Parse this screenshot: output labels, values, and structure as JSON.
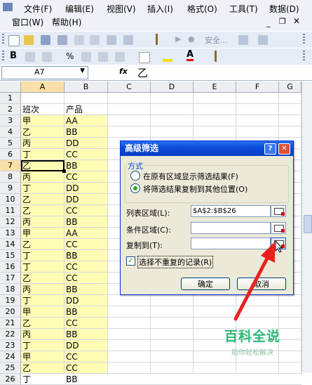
{
  "menu": {
    "row1": [
      "文件(F)",
      "编辑(E)",
      "视图(V)",
      "插入(I)",
      "格式(O)",
      "工具(T)",
      "数据(D)"
    ],
    "row2": [
      "窗口(W)",
      "帮助(H)"
    ]
  },
  "toolbar": {
    "security_label": "安全..."
  },
  "formula_bar": {
    "name_box": "A7",
    "fx": "fx",
    "content": "乙"
  },
  "grid": {
    "columns": [
      "A",
      "B",
      "C",
      "D",
      "E",
      "F",
      "G"
    ],
    "rows": [
      {
        "n": "1",
        "a": "",
        "b": ""
      },
      {
        "n": "2",
        "a": "班次",
        "b": "产品"
      },
      {
        "n": "3",
        "a": "甲",
        "b": "AA"
      },
      {
        "n": "4",
        "a": "乙",
        "b": "BB"
      },
      {
        "n": "5",
        "a": "丙",
        "b": "DD"
      },
      {
        "n": "6",
        "a": "丁",
        "b": "CC"
      },
      {
        "n": "7",
        "a": "乙",
        "b": "BB"
      },
      {
        "n": "8",
        "a": "丙",
        "b": "CC"
      },
      {
        "n": "9",
        "a": "丁",
        "b": "DD"
      },
      {
        "n": "10",
        "a": "乙",
        "b": "DD"
      },
      {
        "n": "11",
        "a": "乙",
        "b": "CC"
      },
      {
        "n": "12",
        "a": "丙",
        "b": "BB"
      },
      {
        "n": "13",
        "a": "甲",
        "b": "AA"
      },
      {
        "n": "14",
        "a": "乙",
        "b": "CC"
      },
      {
        "n": "15",
        "a": "丁",
        "b": "BB"
      },
      {
        "n": "16",
        "a": "丁",
        "b": "CC"
      },
      {
        "n": "17",
        "a": "乙",
        "b": "CC"
      },
      {
        "n": "18",
        "a": "丙",
        "b": "BB"
      },
      {
        "n": "19",
        "a": "丁",
        "b": "DD"
      },
      {
        "n": "20",
        "a": "甲",
        "b": "BB"
      },
      {
        "n": "21",
        "a": "乙",
        "b": "CC"
      },
      {
        "n": "22",
        "a": "丙",
        "b": "BB"
      },
      {
        "n": "23",
        "a": "丁",
        "b": "DD"
      },
      {
        "n": "24",
        "a": "甲",
        "b": "CC"
      },
      {
        "n": "25",
        "a": "乙",
        "b": "CC"
      },
      {
        "n": "26",
        "a": "丁",
        "b": "BB"
      }
    ]
  },
  "dialog": {
    "title": "高级筛选",
    "method_group": "方式",
    "option1": "在原有区域显示筛选结果(F)",
    "option2": "将筛选结果复制到其他位置(O)",
    "list_range_label": "列表区域(L):",
    "list_range_value": "$A$2:$B$26",
    "criteria_range_label": "条件区域(C):",
    "criteria_range_value": "",
    "copy_to_label": "复制到(T):",
    "copy_to_value": "",
    "unique_label": "选择不重复的记录(R)",
    "ok": "确定",
    "cancel": "取消"
  },
  "watermark": {
    "brand": "百科全说",
    "sub": "助你轻松解决"
  },
  "colors": {
    "highlight": "#fffcb4",
    "title_blue": "#0a4bd8",
    "arrow": "#e8211d",
    "brand_green": "#2eb872"
  }
}
